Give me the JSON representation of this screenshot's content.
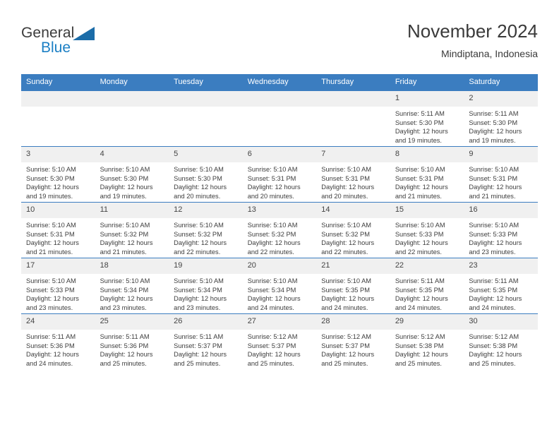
{
  "brand": {
    "name_top": "General",
    "name_bottom": "Blue",
    "colors": {
      "general_text": "#3b3b3b",
      "blue_text": "#1b7fc4",
      "triangle": "#1b6ca8"
    }
  },
  "header": {
    "title": "November 2024",
    "subtitle": "Mindiptana, Indonesia"
  },
  "theme": {
    "header_bg": "#3b7dc0",
    "header_text": "#ffffff",
    "daynum_bg": "#f0f0f0",
    "grid_line": "#3b7dc0",
    "body_text": "#3d3d3d"
  },
  "weekdays": [
    "Sunday",
    "Monday",
    "Tuesday",
    "Wednesday",
    "Thursday",
    "Friday",
    "Saturday"
  ],
  "labels": {
    "sunrise": "Sunrise:",
    "sunset": "Sunset:",
    "daylight": "Daylight:"
  },
  "weeks": [
    [
      {
        "day": "",
        "empty": true
      },
      {
        "day": "",
        "empty": true
      },
      {
        "day": "",
        "empty": true
      },
      {
        "day": "",
        "empty": true
      },
      {
        "day": "",
        "empty": true
      },
      {
        "day": "1",
        "sunrise": "Sunrise: 5:11 AM",
        "sunset": "Sunset: 5:30 PM",
        "daylight": "Daylight: 12 hours and 19 minutes."
      },
      {
        "day": "2",
        "sunrise": "Sunrise: 5:11 AM",
        "sunset": "Sunset: 5:30 PM",
        "daylight": "Daylight: 12 hours and 19 minutes."
      }
    ],
    [
      {
        "day": "3",
        "sunrise": "Sunrise: 5:10 AM",
        "sunset": "Sunset: 5:30 PM",
        "daylight": "Daylight: 12 hours and 19 minutes."
      },
      {
        "day": "4",
        "sunrise": "Sunrise: 5:10 AM",
        "sunset": "Sunset: 5:30 PM",
        "daylight": "Daylight: 12 hours and 19 minutes."
      },
      {
        "day": "5",
        "sunrise": "Sunrise: 5:10 AM",
        "sunset": "Sunset: 5:30 PM",
        "daylight": "Daylight: 12 hours and 20 minutes."
      },
      {
        "day": "6",
        "sunrise": "Sunrise: 5:10 AM",
        "sunset": "Sunset: 5:31 PM",
        "daylight": "Daylight: 12 hours and 20 minutes."
      },
      {
        "day": "7",
        "sunrise": "Sunrise: 5:10 AM",
        "sunset": "Sunset: 5:31 PM",
        "daylight": "Daylight: 12 hours and 20 minutes."
      },
      {
        "day": "8",
        "sunrise": "Sunrise: 5:10 AM",
        "sunset": "Sunset: 5:31 PM",
        "daylight": "Daylight: 12 hours and 21 minutes."
      },
      {
        "day": "9",
        "sunrise": "Sunrise: 5:10 AM",
        "sunset": "Sunset: 5:31 PM",
        "daylight": "Daylight: 12 hours and 21 minutes."
      }
    ],
    [
      {
        "day": "10",
        "sunrise": "Sunrise: 5:10 AM",
        "sunset": "Sunset: 5:31 PM",
        "daylight": "Daylight: 12 hours and 21 minutes."
      },
      {
        "day": "11",
        "sunrise": "Sunrise: 5:10 AM",
        "sunset": "Sunset: 5:32 PM",
        "daylight": "Daylight: 12 hours and 21 minutes."
      },
      {
        "day": "12",
        "sunrise": "Sunrise: 5:10 AM",
        "sunset": "Sunset: 5:32 PM",
        "daylight": "Daylight: 12 hours and 22 minutes."
      },
      {
        "day": "13",
        "sunrise": "Sunrise: 5:10 AM",
        "sunset": "Sunset: 5:32 PM",
        "daylight": "Daylight: 12 hours and 22 minutes."
      },
      {
        "day": "14",
        "sunrise": "Sunrise: 5:10 AM",
        "sunset": "Sunset: 5:32 PM",
        "daylight": "Daylight: 12 hours and 22 minutes."
      },
      {
        "day": "15",
        "sunrise": "Sunrise: 5:10 AM",
        "sunset": "Sunset: 5:33 PM",
        "daylight": "Daylight: 12 hours and 22 minutes."
      },
      {
        "day": "16",
        "sunrise": "Sunrise: 5:10 AM",
        "sunset": "Sunset: 5:33 PM",
        "daylight": "Daylight: 12 hours and 23 minutes."
      }
    ],
    [
      {
        "day": "17",
        "sunrise": "Sunrise: 5:10 AM",
        "sunset": "Sunset: 5:33 PM",
        "daylight": "Daylight: 12 hours and 23 minutes."
      },
      {
        "day": "18",
        "sunrise": "Sunrise: 5:10 AM",
        "sunset": "Sunset: 5:34 PM",
        "daylight": "Daylight: 12 hours and 23 minutes."
      },
      {
        "day": "19",
        "sunrise": "Sunrise: 5:10 AM",
        "sunset": "Sunset: 5:34 PM",
        "daylight": "Daylight: 12 hours and 23 minutes."
      },
      {
        "day": "20",
        "sunrise": "Sunrise: 5:10 AM",
        "sunset": "Sunset: 5:34 PM",
        "daylight": "Daylight: 12 hours and 24 minutes."
      },
      {
        "day": "21",
        "sunrise": "Sunrise: 5:10 AM",
        "sunset": "Sunset: 5:35 PM",
        "daylight": "Daylight: 12 hours and 24 minutes."
      },
      {
        "day": "22",
        "sunrise": "Sunrise: 5:11 AM",
        "sunset": "Sunset: 5:35 PM",
        "daylight": "Daylight: 12 hours and 24 minutes."
      },
      {
        "day": "23",
        "sunrise": "Sunrise: 5:11 AM",
        "sunset": "Sunset: 5:35 PM",
        "daylight": "Daylight: 12 hours and 24 minutes."
      }
    ],
    [
      {
        "day": "24",
        "sunrise": "Sunrise: 5:11 AM",
        "sunset": "Sunset: 5:36 PM",
        "daylight": "Daylight: 12 hours and 24 minutes."
      },
      {
        "day": "25",
        "sunrise": "Sunrise: 5:11 AM",
        "sunset": "Sunset: 5:36 PM",
        "daylight": "Daylight: 12 hours and 25 minutes."
      },
      {
        "day": "26",
        "sunrise": "Sunrise: 5:11 AM",
        "sunset": "Sunset: 5:37 PM",
        "daylight": "Daylight: 12 hours and 25 minutes."
      },
      {
        "day": "27",
        "sunrise": "Sunrise: 5:12 AM",
        "sunset": "Sunset: 5:37 PM",
        "daylight": "Daylight: 12 hours and 25 minutes."
      },
      {
        "day": "28",
        "sunrise": "Sunrise: 5:12 AM",
        "sunset": "Sunset: 5:37 PM",
        "daylight": "Daylight: 12 hours and 25 minutes."
      },
      {
        "day": "29",
        "sunrise": "Sunrise: 5:12 AM",
        "sunset": "Sunset: 5:38 PM",
        "daylight": "Daylight: 12 hours and 25 minutes."
      },
      {
        "day": "30",
        "sunrise": "Sunrise: 5:12 AM",
        "sunset": "Sunset: 5:38 PM",
        "daylight": "Daylight: 12 hours and 25 minutes."
      }
    ]
  ]
}
